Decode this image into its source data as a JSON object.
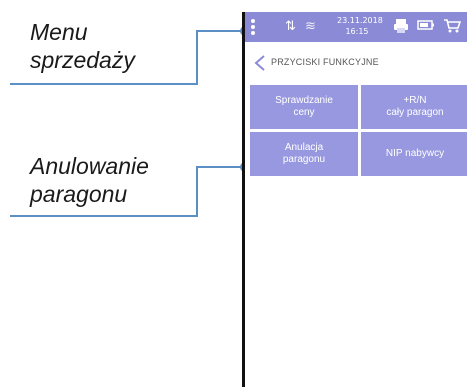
{
  "callouts": {
    "menu_line1": "Menu",
    "menu_line2": "sprzedaży",
    "anulowanie_line1": "Anulowanie",
    "anulowanie_line2": "paragonu"
  },
  "status_bar": {
    "date": "23.11.2018",
    "time": "16:15",
    "icons": [
      "menu-dots-icon",
      "signal-icon",
      "wifi-icon",
      "printer-icon",
      "battery-icon",
      "cart-icon"
    ]
  },
  "header": {
    "title": "PRZYCISKI FUNKCYJNE"
  },
  "function_buttons": [
    {
      "line1": "Sprawdzanie",
      "line2": "ceny"
    },
    {
      "line1": "+R/N",
      "line2": "cały paragon"
    },
    {
      "line1": "Anulacja",
      "line2": "paragonu"
    },
    {
      "line1": "NIP nabywcy",
      "line2": ""
    }
  ],
  "colors": {
    "accent": "#8a8ad6",
    "button": "#9898e0",
    "callout_line": "#5b8fc6"
  }
}
